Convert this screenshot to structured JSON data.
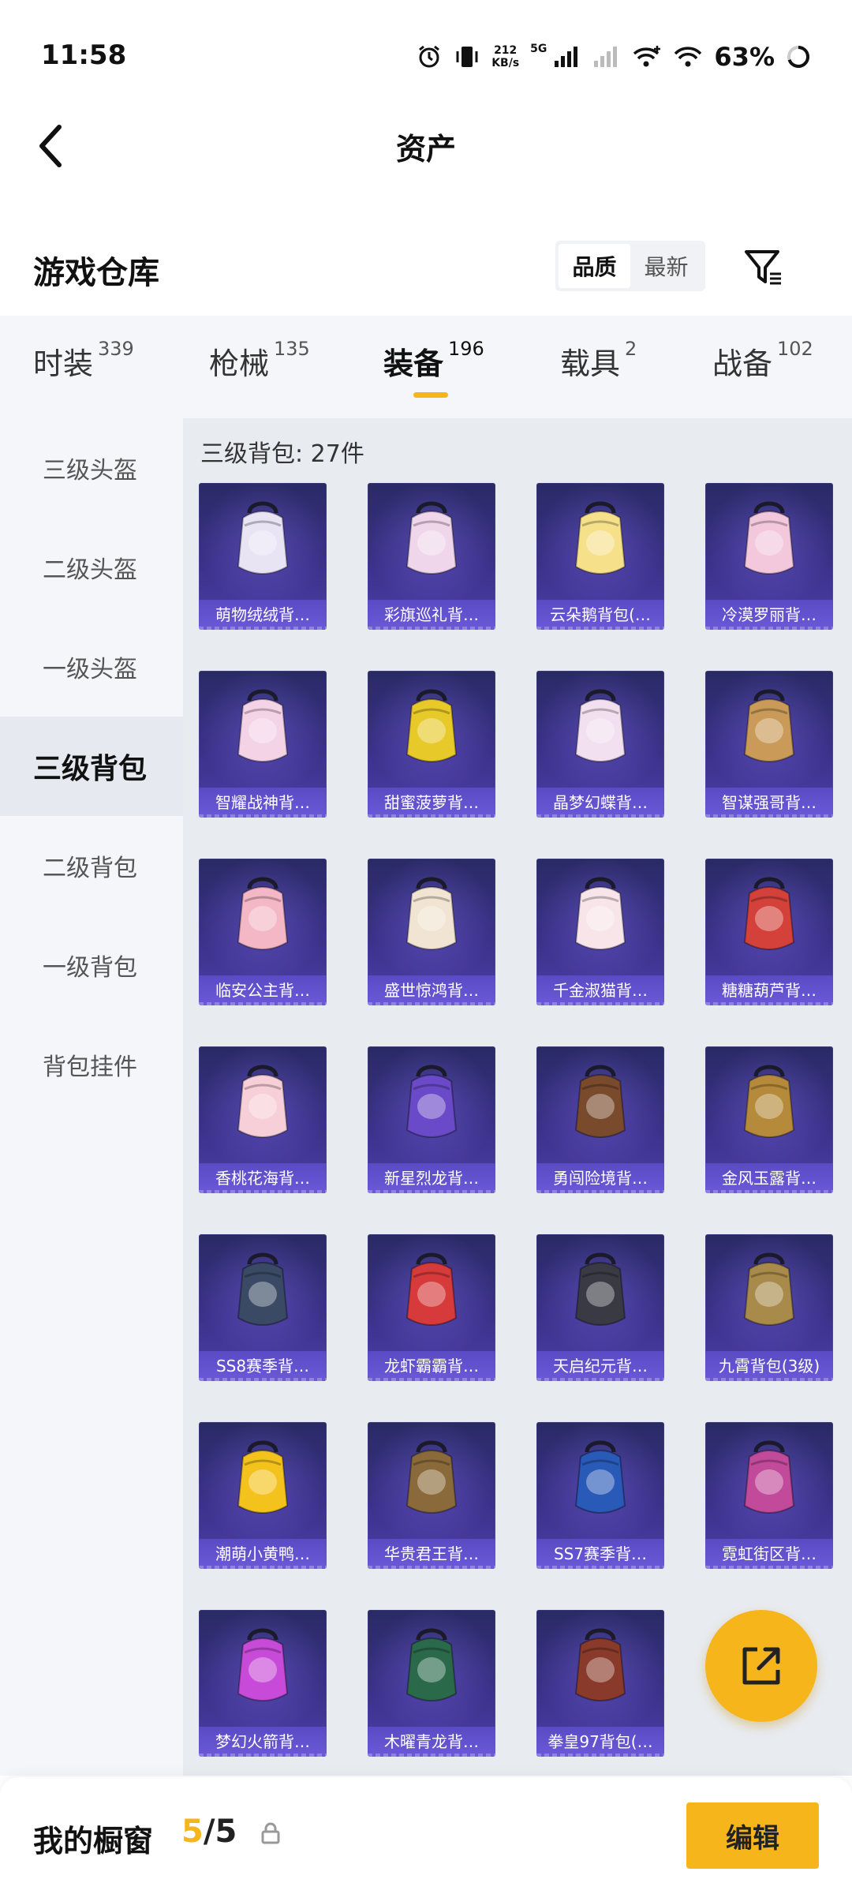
{
  "status_bar": {
    "time": "11:58",
    "speed_value": "212",
    "speed_unit": "KB/s",
    "network": "5G",
    "battery": "63%"
  },
  "header": {
    "title": "资产",
    "back_icon": "chevron-left-icon"
  },
  "warehouse": {
    "title": "游戏仓库",
    "sort_options": [
      "品质",
      "最新"
    ],
    "active_sort": "品质",
    "filter_icon": "filter-icon"
  },
  "tabs": [
    {
      "label": "时装",
      "count": "339"
    },
    {
      "label": "枪械",
      "count": "135"
    },
    {
      "label": "装备",
      "count": "196",
      "active": true
    },
    {
      "label": "载具",
      "count": "2"
    },
    {
      "label": "战备",
      "count": "102"
    }
  ],
  "sidebar": {
    "items": [
      {
        "label": "三级头盔"
      },
      {
        "label": "二级头盔"
      },
      {
        "label": "一级头盔"
      },
      {
        "label": "三级背包",
        "active": true
      },
      {
        "label": "二级背包"
      },
      {
        "label": "一级背包"
      },
      {
        "label": "背包挂件"
      }
    ]
  },
  "main": {
    "section_title": "三级背包: 27件",
    "items": [
      {
        "name": "萌物绒绒背…",
        "color": "#e8e4f4"
      },
      {
        "name": "彩旗巡礼背…",
        "color": "#f0d6ea"
      },
      {
        "name": "云朵鹅背包(…",
        "color": "#f6e08a"
      },
      {
        "name": "冷漠罗丽背…",
        "color": "#f3c7dc"
      },
      {
        "name": "智耀战神背…",
        "color": "#f4d3e6"
      },
      {
        "name": "甜蜜菠萝背…",
        "color": "#e8c92a"
      },
      {
        "name": "晶梦幻蝶背…",
        "color": "#f2dff0"
      },
      {
        "name": "智谋强哥背…",
        "color": "#c99a58"
      },
      {
        "name": "临安公主背…",
        "color": "#f4b7c6"
      },
      {
        "name": "盛世惊鸿背…",
        "color": "#f2e4d2"
      },
      {
        "name": "千金淑猫背…",
        "color": "#f7e5ea"
      },
      {
        "name": "糖糖葫芦背…",
        "color": "#d4413a"
      },
      {
        "name": "香桃花海背…",
        "color": "#f7cfd8"
      },
      {
        "name": "新星烈龙背…",
        "color": "#6a4ac8"
      },
      {
        "name": "勇闯险境背…",
        "color": "#7a4a2c"
      },
      {
        "name": "金风玉露背…",
        "color": "#b58a3a"
      },
      {
        "name": "SS8赛季背…",
        "color": "#3a4a64"
      },
      {
        "name": "龙虾霸霸背…",
        "color": "#d63a3a"
      },
      {
        "name": "天启纪元背…",
        "color": "#3a3a44"
      },
      {
        "name": "九霄背包(3级)",
        "color": "#a88a4a"
      },
      {
        "name": "潮萌小黄鸭…",
        "color": "#f4c21c"
      },
      {
        "name": "华贵君王背…",
        "color": "#8a6a3a"
      },
      {
        "name": "SS7赛季背…",
        "color": "#2a5ab8"
      },
      {
        "name": "霓虹街区背…",
        "color": "#c24a9a"
      },
      {
        "name": "梦幻火箭背…",
        "color": "#c84ad8"
      },
      {
        "name": "木曜青龙背…",
        "color": "#2a6a4a"
      },
      {
        "name": "拳皇97背包(…",
        "color": "#8a3a2a"
      }
    ]
  },
  "share_button": {
    "icon": "share-icon"
  },
  "bottom_bar": {
    "showcase_label": "我的橱窗",
    "showcase_current": "5",
    "showcase_total": "/5",
    "lock_icon": "lock-icon",
    "edit_label": "编辑"
  },
  "colors": {
    "accent": "#f6b51a",
    "card_bg": "#3b3189",
    "card_label_bg": "#6b59d8"
  }
}
